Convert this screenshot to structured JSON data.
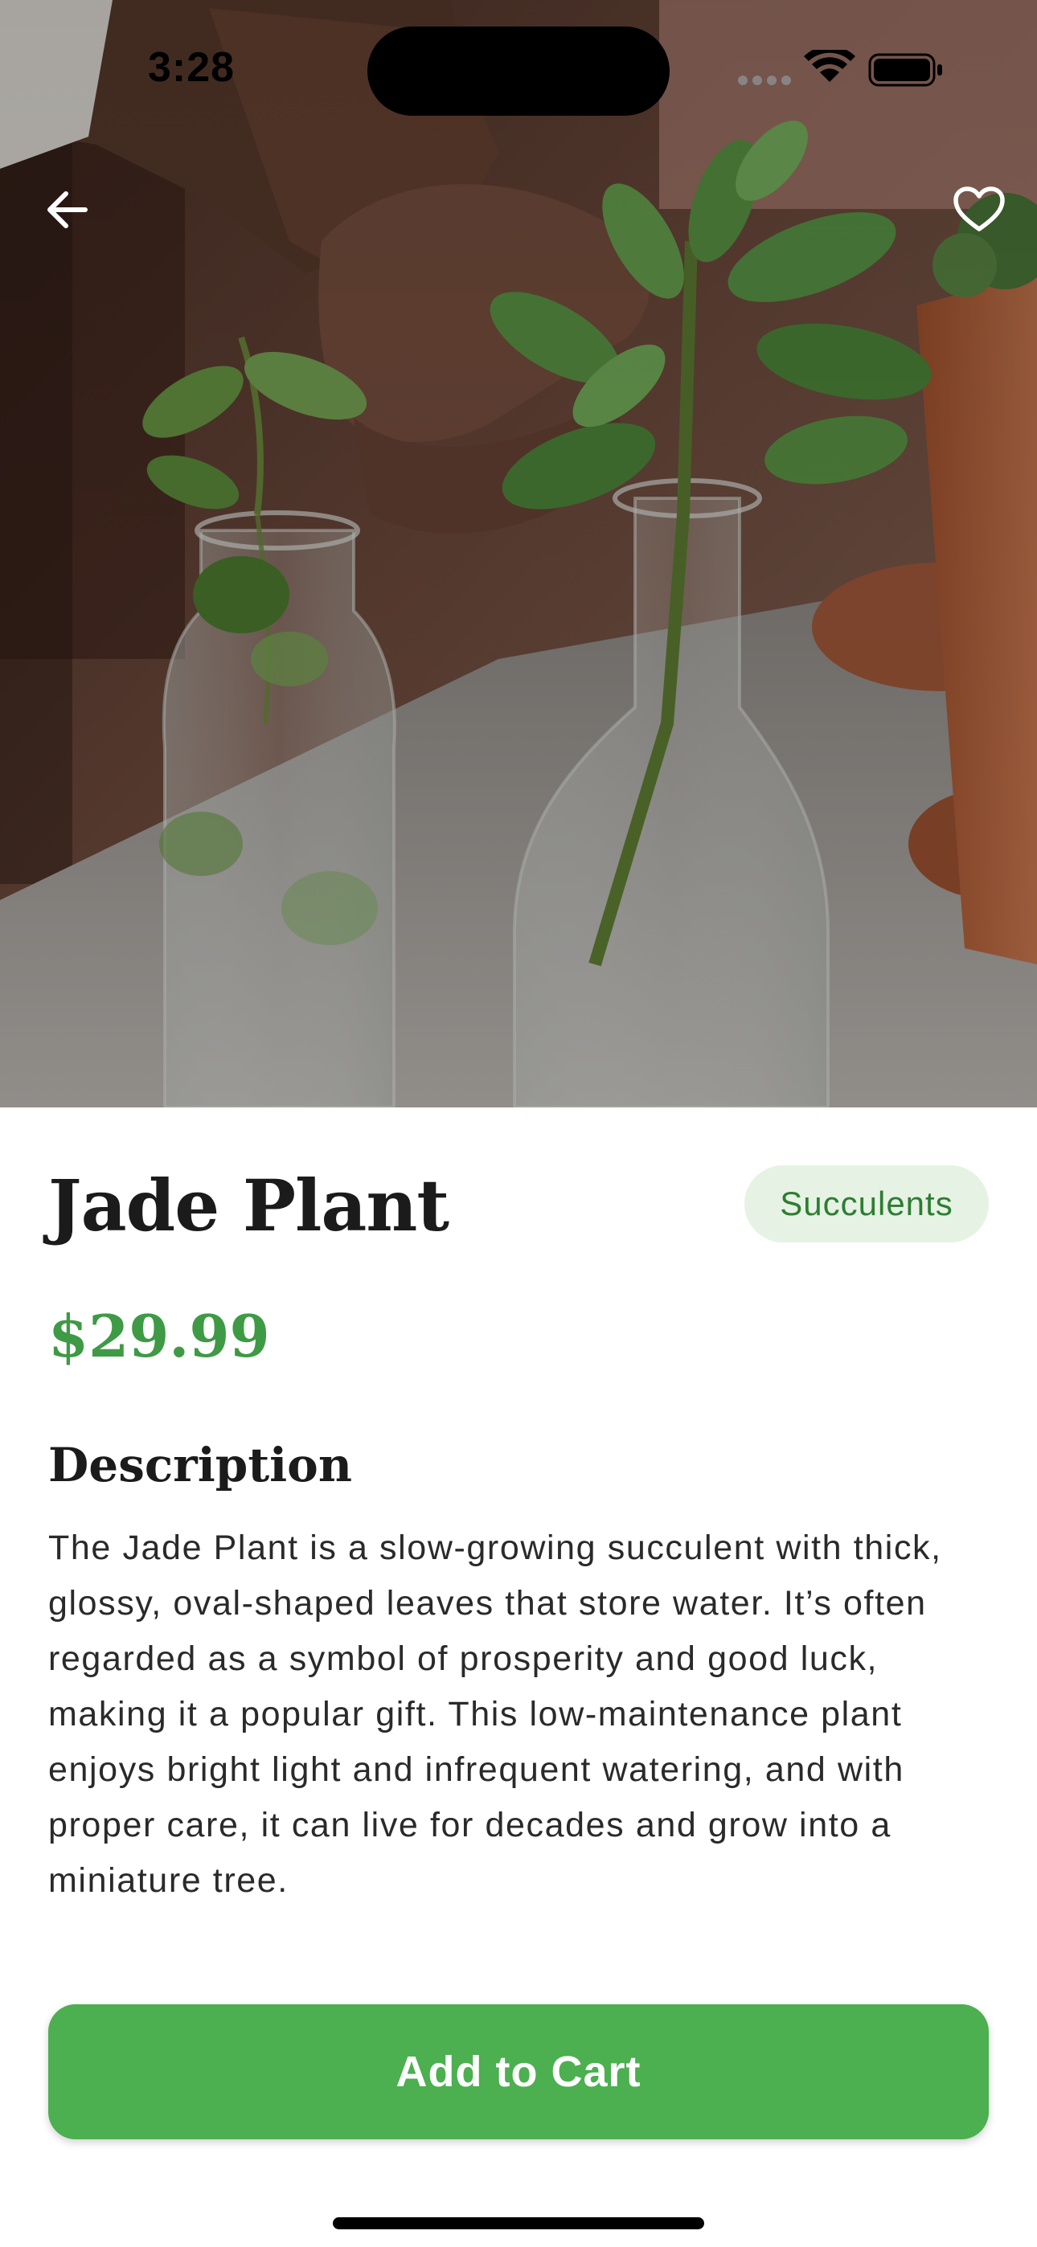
{
  "status_bar": {
    "time": "3:28"
  },
  "nav": {
    "back_icon": "arrow-left-icon",
    "favorite_icon": "heart-outline-icon"
  },
  "product": {
    "name": "Jade Plant",
    "category": "Succulents",
    "price": "$29.99",
    "description_heading": "Description",
    "description": "The Jade Plant is a slow-growing succulent with thick, glossy, oval-shaped leaves that store water. It’s often regarded as a symbol of prosperity and good luck, making it a popular gift. This low-maintenance plant enjoys bright light and infrequent watering, and with proper care, it can live for decades and grow into a miniature tree."
  },
  "actions": {
    "add_to_cart_label": "Add to Cart"
  },
  "colors": {
    "accent_green": "#4caf50",
    "price_green": "#3e9a45",
    "chip_background": "#e6f3e4",
    "chip_text": "#2e7d32"
  }
}
